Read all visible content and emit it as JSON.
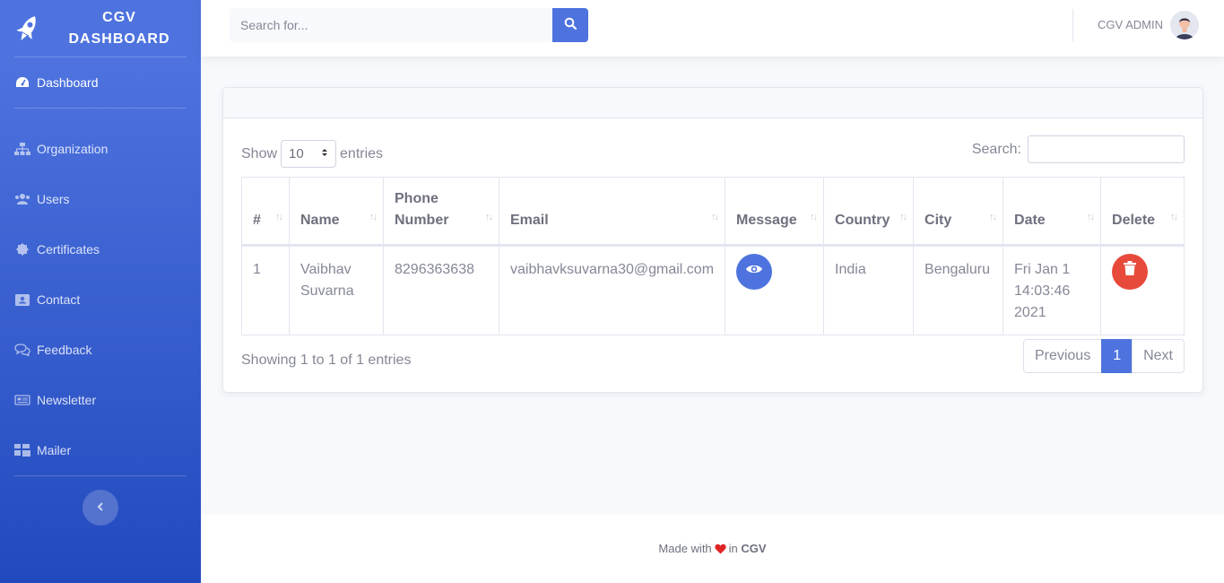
{
  "brand": {
    "line1": "CGV",
    "line2": "DASHBOARD"
  },
  "sidebar": {
    "items": [
      {
        "label": "Dashboard",
        "icon": "tachometer-icon"
      },
      {
        "label": "Organization",
        "icon": "sitemap-icon"
      },
      {
        "label": "Users",
        "icon": "users-icon"
      },
      {
        "label": "Certificates",
        "icon": "certificate-icon"
      },
      {
        "label": "Contact",
        "icon": "address-book-icon"
      },
      {
        "label": "Feedback",
        "icon": "comments-icon"
      },
      {
        "label": "Newsletter",
        "icon": "newspaper-icon"
      },
      {
        "label": "Mailer",
        "icon": "mail-bulk-icon"
      }
    ]
  },
  "topbar": {
    "search_placeholder": "Search for...",
    "user_name": "CGV ADMIN"
  },
  "datatable": {
    "show_label": "Show",
    "entries_label": "entries",
    "page_length": "10",
    "search_label": "Search:",
    "columns": [
      "#",
      "Name",
      "Phone Number",
      "Email",
      "Message",
      "Country",
      "City",
      "Date",
      "Delete"
    ],
    "rows": [
      {
        "index": "1",
        "name": "Vaibhav Suvarna",
        "phone": "8296363638",
        "email": "vaibhavksuvarna30@gmail.com",
        "country": "India",
        "city": "Bengaluru",
        "date": "Fri Jan 1 14:03:46 2021"
      }
    ],
    "info": "Showing 1 to 1 of 1 entries",
    "pagination": {
      "previous": "Previous",
      "current": "1",
      "next": "Next"
    }
  },
  "footer": {
    "made_with": "Made with",
    "in": "in",
    "brand": "CGV"
  },
  "colors": {
    "primary": "#4e73df",
    "danger": "#e74a3b",
    "heart": "#e02424"
  }
}
